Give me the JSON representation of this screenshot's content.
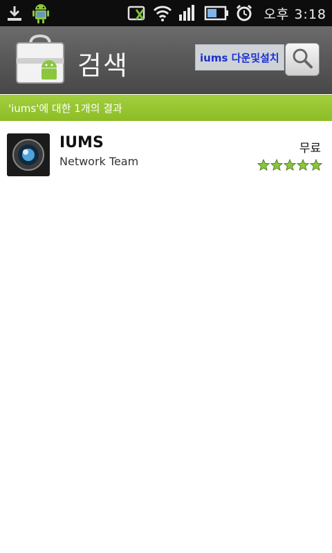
{
  "status_bar": {
    "time": "오후 3:18",
    "icons": [
      "download-icon",
      "android-icon",
      "sim-icon",
      "wifi-icon",
      "signal-icon",
      "battery-icon",
      "alarm-icon"
    ]
  },
  "header": {
    "title": "검색",
    "query_chip": "iums 다운및설치",
    "logo_icon": "market-bag-icon",
    "search_icon": "magnifier-icon"
  },
  "results_banner": {
    "text": "'iums'에 대한 1개의 결과"
  },
  "results": [
    {
      "name": "IUMS",
      "developer": "Network Team",
      "price": "무료",
      "rating": 5,
      "rating_max": 5
    }
  ],
  "colors": {
    "banner_green": "#98c530",
    "query_text": "#1a2fd0",
    "star_green": "#8cc63f"
  }
}
